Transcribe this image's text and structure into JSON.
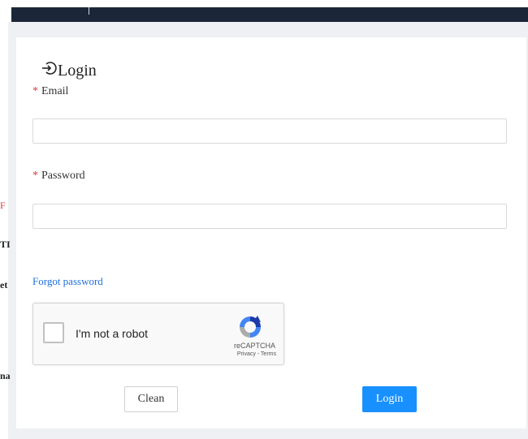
{
  "edge_snippets": [
    "F",
    "TI",
    "et",
    "na"
  ],
  "modal": {
    "title": "Login",
    "email": {
      "required_mark": "*",
      "label": "Email",
      "value": "",
      "placeholder": ""
    },
    "password": {
      "required_mark": "*",
      "label": "Password",
      "value": "",
      "placeholder": ""
    },
    "forgot_link": "Forgot password",
    "captcha": {
      "checkbox_label": "I'm not a robot",
      "brand": "reCAPTCHA",
      "links": "Privacy - Terms",
      "checked": false
    },
    "buttons": {
      "clean": "Clean",
      "login": "Login"
    }
  },
  "colors": {
    "topbar": "#1b2638",
    "required": "#e03a3a",
    "link": "#1e6fd9",
    "primary": "#1890ff"
  },
  "icons": {
    "title_icon": "login-icon",
    "captcha_logo": "recaptcha-logo-icon"
  }
}
